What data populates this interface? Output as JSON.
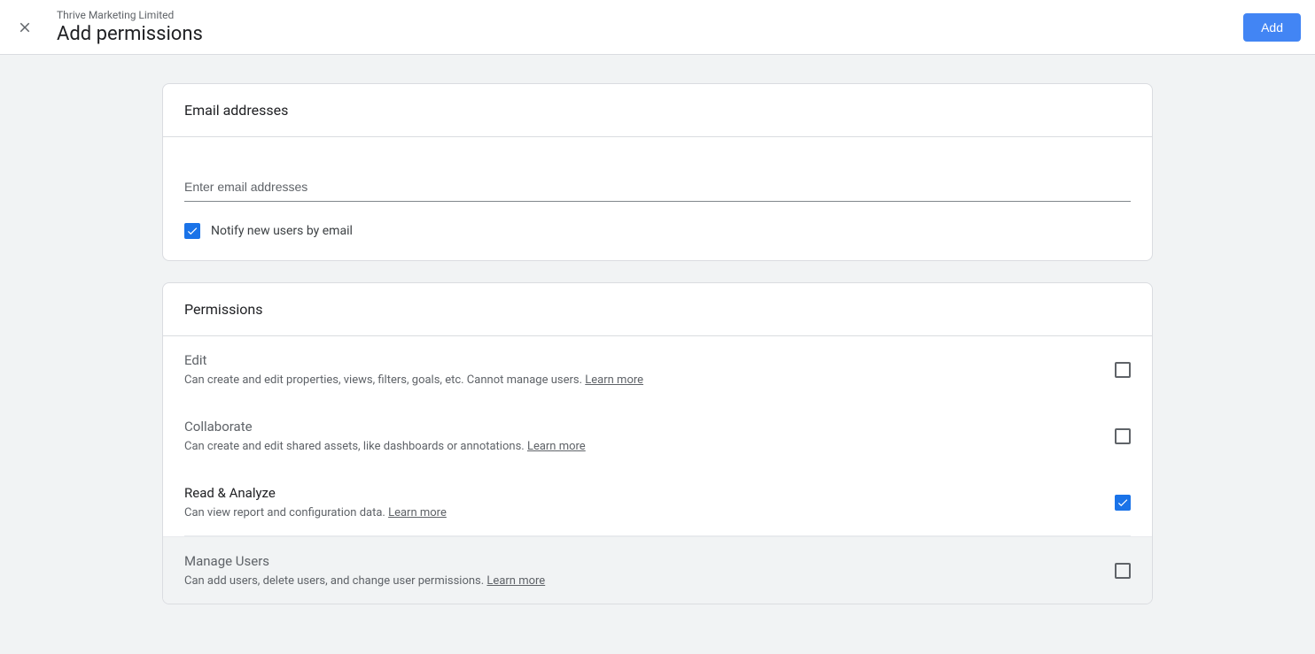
{
  "header": {
    "org_name": "Thrive Marketing Limited",
    "page_title": "Add permissions",
    "add_button": "Add"
  },
  "email_section": {
    "title": "Email addresses",
    "input_placeholder": "Enter email addresses",
    "notify_label": "Notify new users by email",
    "notify_checked": true
  },
  "permissions_section": {
    "title": "Permissions",
    "learn_more": "Learn more",
    "items": [
      {
        "title": "Edit",
        "desc": "Can create and edit properties, views, filters, goals, etc. Cannot manage users. ",
        "checked": false,
        "active": false
      },
      {
        "title": "Collaborate",
        "desc": "Can create and edit shared assets, like dashboards or annotations. ",
        "checked": false,
        "active": false
      },
      {
        "title": "Read & Analyze",
        "desc": "Can view report and configuration data. ",
        "checked": true,
        "active": true
      },
      {
        "title": "Manage Users",
        "desc": "Can add users, delete users, and change user permissions. ",
        "checked": false,
        "active": false
      }
    ]
  }
}
